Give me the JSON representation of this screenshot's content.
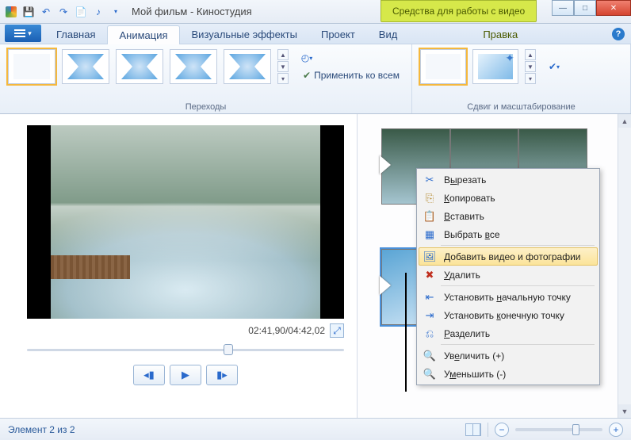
{
  "titlebar": {
    "title": "Мой фильм - Киностудия",
    "contextual_tab": "Средства для работы с видео"
  },
  "win_controls": {
    "min": "—",
    "max": "□",
    "close": "✕"
  },
  "tabs": {
    "home": "Главная",
    "animation": "Анимация",
    "visual_fx": "Визуальные эффекты",
    "project": "Проект",
    "view": "Вид",
    "edit": "Правка"
  },
  "ribbon": {
    "transitions_group": "Переходы",
    "apply_all": "Применить ко всем",
    "panzoom_group": "Сдвиг и масштабирование"
  },
  "preview": {
    "time": "02:41,90/04:42,02"
  },
  "context_menu": {
    "cut": {
      "pre": "В",
      "u": "ы",
      "post": "резать"
    },
    "copy": {
      "pre": "",
      "u": "К",
      "post": "опировать"
    },
    "paste": {
      "pre": "",
      "u": "В",
      "post": "ставить"
    },
    "select_all": {
      "pre": "Выбрать ",
      "u": "в",
      "post": "се"
    },
    "add_media": {
      "pre": "",
      "u": "Д",
      "post": "обавить видео и фотографии"
    },
    "delete": {
      "pre": "",
      "u": "У",
      "post": "далить"
    },
    "set_start": {
      "pre": "Установить ",
      "u": "н",
      "post": "ачальную точку"
    },
    "set_end": {
      "pre": "Установить ",
      "u": "к",
      "post": "онечную точку"
    },
    "split": {
      "pre": "",
      "u": "Р",
      "post": "азделить"
    },
    "zoom_in": {
      "pre": "Ув",
      "u": "е",
      "post": "личить (+)"
    },
    "zoom_out": {
      "pre": "У",
      "u": "м",
      "post": "еньшить (-)"
    }
  },
  "status": {
    "left": "Элемент 2 из 2"
  }
}
